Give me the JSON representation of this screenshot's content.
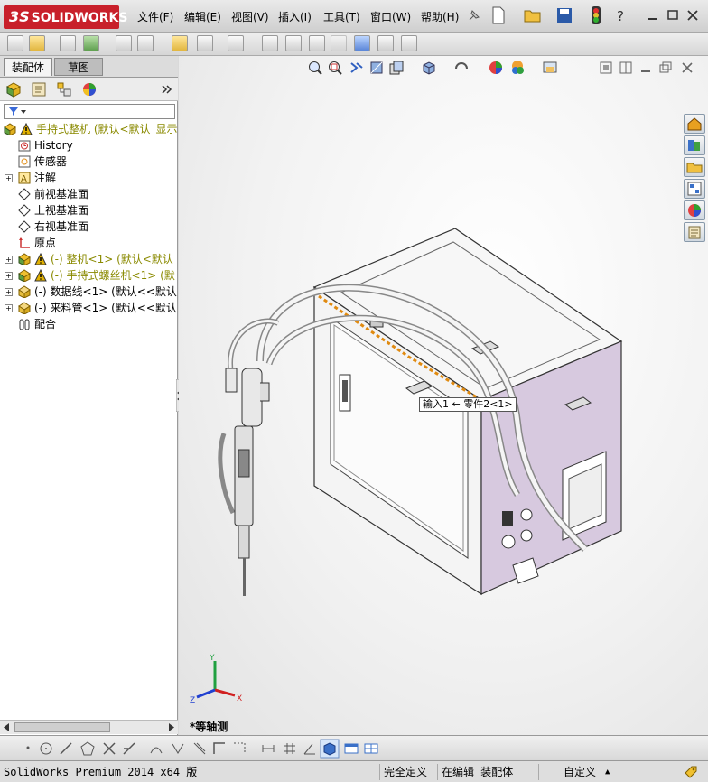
{
  "app": {
    "logo_text": "SOLIDWORKS",
    "logo_prefix": "3S"
  },
  "menu": [
    "文件(F)",
    "编辑(E)",
    "视图(V)",
    "插入(I)",
    "工具(T)",
    "窗口(W)",
    "帮助(H)"
  ],
  "tabs": {
    "assembly": "装配体",
    "sketch": "草图"
  },
  "tree": [
    {
      "label": "手持式整机  (默认<默认_显示",
      "warn": true,
      "expand": "",
      "icon": "assembly-icon"
    },
    {
      "label": "History",
      "warn": false,
      "expand": "",
      "icon": "history-icon"
    },
    {
      "label": "传感器",
      "warn": false,
      "expand": "",
      "icon": "sensor-icon"
    },
    {
      "label": "注解",
      "warn": false,
      "expand": "+",
      "icon": "annotation-icon"
    },
    {
      "label": "前视基准面",
      "warn": false,
      "expand": "",
      "icon": "plane-icon"
    },
    {
      "label": "上视基准面",
      "warn": false,
      "expand": "",
      "icon": "plane-icon"
    },
    {
      "label": "右视基准面",
      "warn": false,
      "expand": "",
      "icon": "plane-icon"
    },
    {
      "label": "原点",
      "warn": false,
      "expand": "",
      "icon": "origin-icon"
    },
    {
      "label": "(-) 整机<1> (默认<默认_",
      "warn": true,
      "expand": "+",
      "icon": "subassembly-icon"
    },
    {
      "label": "(-) 手持式螺丝机<1> (默",
      "warn": true,
      "expand": "+",
      "icon": "subassembly-icon"
    },
    {
      "label": "(-) 数据线<1> (默认<<默认",
      "warn": false,
      "expand": "+",
      "icon": "part-icon"
    },
    {
      "label": "(-) 来料管<1> (默认<<默认",
      "warn": false,
      "expand": "+",
      "icon": "part-icon"
    },
    {
      "label": "配合",
      "warn": false,
      "expand": "",
      "icon": "mates-icon"
    }
  ],
  "viewport": {
    "tooltip": "输入1 ← 零件2<1>",
    "view_name": "*等轴测",
    "triad": {
      "x": "X",
      "y": "Y",
      "z": "Z"
    }
  },
  "status": {
    "product": "SolidWorks Premium 2014 x64 版",
    "definition": "完全定义",
    "mode": "在编辑 装配体",
    "units": "自定义",
    "units_arrow": "▲"
  },
  "colors": {
    "accent": "#c8202a",
    "box_side": "#d6c8e0",
    "warning": "#e0b000"
  }
}
